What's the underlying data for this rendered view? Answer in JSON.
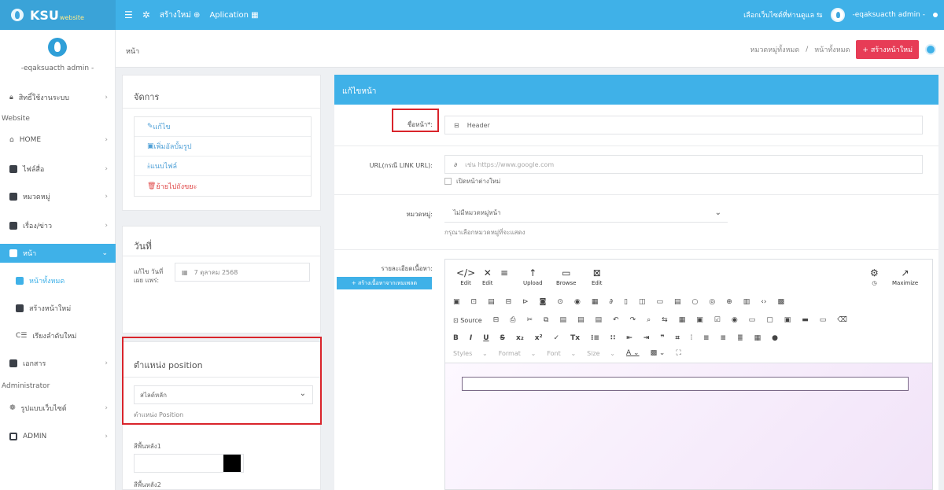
{
  "topbar": {
    "brand": "KSU",
    "brand_sub": "website",
    "menu_icon": "☰",
    "nav_create": "สร้างใหม่ ⊕",
    "nav_application": "Aplication ▦",
    "select_website": "เลือกเว็บไซต์ที่ท่านดูแล ⇆",
    "user": "-eqaksuacth admin -"
  },
  "sidebar": {
    "profile_name": "-eqaksuacth admin -",
    "items": [
      {
        "label": "สิทธิ์ใช้งานระบบ",
        "icon": "lock-icon"
      },
      {
        "label": "HOME",
        "icon": "home-icon"
      },
      {
        "label": "ไฟล์สื่อ",
        "icon": "media-icon"
      },
      {
        "label": "หมวดหมู่",
        "icon": "category-icon"
      },
      {
        "label": "เรื่อง/ข่าว",
        "icon": "news-icon"
      },
      {
        "label": "หน้า",
        "icon": "page-icon"
      },
      {
        "label": "หน้าทั้งหมด",
        "icon": "all-pages-icon"
      },
      {
        "label": "สร้างหน้าใหม่",
        "icon": "new-page-icon"
      },
      {
        "label": "เรียงลำดับใหม่",
        "icon": "sort-icon"
      },
      {
        "label": "เอกสาร",
        "icon": "document-icon"
      },
      {
        "label": "รูปแบบเว็บไซต์",
        "icon": "palette-icon"
      },
      {
        "label": "ADMIN",
        "icon": "admin-icon"
      }
    ],
    "section_website": "Website",
    "section_admin": "Administrator"
  },
  "crumbbar": {
    "title": "หน้า",
    "crumb1": "หมวดหมู่ทั้งหมด",
    "sep": "/",
    "crumb2": "หน้าทั้งหมด",
    "add_button": "+ สร้างหน้าใหม่"
  },
  "manage": {
    "title": "จัดการ",
    "items": [
      "แก้ไข",
      "เพิ่มอัลบั้มรูป",
      "แนบไฟล์",
      "ย้ายไปถังขยะ"
    ]
  },
  "date": {
    "title": "วันที่",
    "label": "แก้ไข วันที่ เผย แพร่:",
    "value": "7 ตุลาคม 2568"
  },
  "position": {
    "title": "ตำแหน่ง position",
    "selected": "สไลด์หลัก",
    "help": "ตำแหน่ง Position"
  },
  "background": {
    "label1": "สีพื้นหลัง1",
    "label2": "สีพื้นหลัง2",
    "color1": "#000000"
  },
  "edit": {
    "header": "แก้ไขหน้า",
    "name_label": "ชื่อหน้า*:",
    "name_value": "Header",
    "url_label": "URL(กรณี LINK URL):",
    "url_placeholder": "เช่น https://www.google.com",
    "new_window": "เปิดหน้าต่างใหม่",
    "category_label": "หมวดหมู่:",
    "category_value": "ไม่มีหมวดหมู่หน้า",
    "category_help": "กรุณาเลือกหมวดหมู่ที่จะแสดง",
    "detail_label": "รายละเอียดเนื้อหา:",
    "template_button": "+ สร้างเนื้อหาจากเทมเพลต"
  },
  "editor": {
    "big_buttons": [
      {
        "label": "Edit",
        "glyph": "</>"
      },
      {
        "label": "Edit",
        "glyph": "✕"
      },
      {
        "label": "Upload",
        "glyph": "↑"
      },
      {
        "label": "Browse",
        "glyph": "▭"
      },
      {
        "label": "Edit",
        "glyph": "⊠"
      },
      {
        "label": "Maximize",
        "glyph": "↗"
      }
    ],
    "source": "Source",
    "styles": "Styles",
    "format": "Format",
    "font": "Font",
    "size": "Size"
  }
}
